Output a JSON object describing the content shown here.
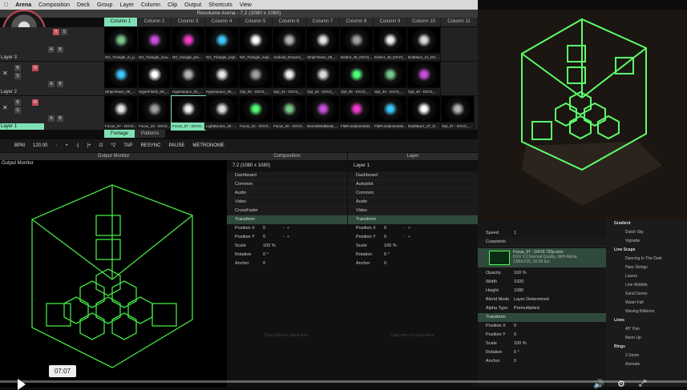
{
  "menu": [
    "Arena",
    "Composition",
    "Deck",
    "Group",
    "Layer",
    "Column",
    "Clip",
    "Output",
    "Shortcuts",
    "View"
  ],
  "window_title": "Resolume Arena - 7.2 (1080 x 1080)",
  "columns": [
    "Column 1",
    "Column 2",
    "Column 3",
    "Column 4",
    "Column 5",
    "Column 6",
    "Column 7",
    "Column 8",
    "Column 9",
    "Column 10",
    "Column 11"
  ],
  "layers": [
    {
      "name": "Layer 3",
      "clips": [
        "NG_Triangle_m_p...",
        "NG_Triangle_inou...",
        "NG_triangle_pre...",
        "NG_Triangle_expl...",
        "NG_Triangle_expl...",
        "Android_Dreams_...",
        "StripeTease_09_...",
        "Enter4_45_DXV3_...",
        "Enter4_46_DXV3_...",
        "DotMaze_12_DX..."
      ]
    },
    {
      "name": "Layer 2",
      "clips": [
        "StripeTease_09_...",
        "HyperFields_08_...",
        "Hyperspace_04_...",
        "Hyperspace_05_...",
        "Opt_05 - DXV3_...",
        "Opt_34 - DXV3_...",
        "Opt_26 - DXV3_...",
        "Opt_05 - DXV3_...",
        "Opt_34 - DXV3_...",
        "Opt_40 - DXV3_..."
      ]
    },
    {
      "name": "Layer 1",
      "clips": [
        "Focus_07 - DXV3...",
        "Focus_23 - DXV3...",
        "Focus_07 - DXV3...",
        "LightBooms_48 -...",
        "Focus_02 - DXV3...",
        "Focus_20 - DXV3...",
        "NeonMetalBeats_...",
        "FlatFundamentals...",
        "FlatFundamentals...",
        "DashBuzz_37_D...",
        "Opt_37 - DXV3_..."
      ]
    }
  ],
  "deck_tabs": [
    "Footage",
    "Patterns"
  ],
  "transport": {
    "bpm_label": "BPM",
    "bpm": "120.00",
    "minus": "-",
    "plus": "+",
    "div2": "/2",
    "mul2": "*2",
    "tap": "TAP",
    "resync": "RESYNC",
    "pause": "PAUSE",
    "metronome": "METRONOME",
    "prev": "-|",
    "next": "|+"
  },
  "panels": {
    "output_monitor": "Output Monitor",
    "composition": "Composition",
    "layer": "Layer",
    "comp_name": "7.2 (1080 x 1080)",
    "layer_name": "Layer 1",
    "drop_hint": "Drag effect to stack here."
  },
  "comp_sections": [
    "Dashboard",
    "Common",
    "Audio",
    "Video",
    "CrossFader"
  ],
  "layer_sections": [
    "Dashboard",
    "Autopilot",
    "Common",
    "Audio",
    "Video"
  ],
  "transform": {
    "title": "Transform",
    "pos_x": "Position X",
    "pos_y": "Position Y",
    "scale": "Scale",
    "rotation": "Rotation",
    "anchor": "Anchor",
    "zero": "0",
    "scale_val": "100 %",
    "rot_val": "0 °"
  },
  "clip_panel": {
    "speed": "Speed",
    "speed_val": "1",
    "cuepoints": "Cuepoints",
    "clip_title": "Focus_07 - DXV3 720p.mov",
    "clip_desc": "DXV 3.0 Normal Quality, With Alpha, 1280x720, 30.00 fps.",
    "opacity": "Opacity",
    "opacity_val": "100 %",
    "width": "Width",
    "width_val": "1920",
    "height": "Height",
    "height_val": "1080",
    "blend": "Blend Mode",
    "blend_val": "Layer Determined",
    "alpha": "Alpha Type",
    "alpha_val": "Premultiplied"
  },
  "effects": [
    {
      "cat": "Gradient",
      "items": [
        "Dutch Sky",
        "Vignette"
      ]
    },
    {
      "cat": "Line Scape",
      "items": [
        "Dancing In The Dark",
        "Harp Strings",
        "Lasers",
        "Line Wobble",
        "Sand Dunes",
        "Water Fall",
        "Waving Ribbons"
      ]
    },
    {
      "cat": "Lines",
      "items": [
        "45° Pan",
        "Neon Up"
      ]
    },
    {
      "cat": "Rings",
      "items": [
        "3 Some",
        "Animate"
      ]
    }
  ],
  "player": {
    "time": "07:07"
  },
  "colors": {
    "accent": "#7fe0b5",
    "neon": "#4dff4d"
  }
}
